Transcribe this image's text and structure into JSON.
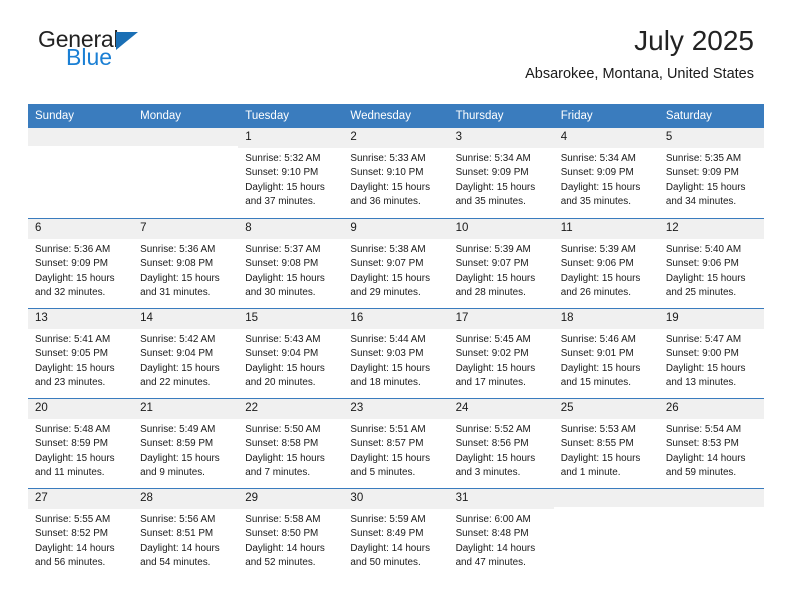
{
  "brand": {
    "line1": "General",
    "line2": "Blue",
    "triangle_color": "#1a6fb5",
    "blue_color": "#1a7fd4"
  },
  "header": {
    "title": "July 2025",
    "subtitle": "Absarokee, Montana, United States"
  },
  "theme": {
    "header_blue": "#3a7cbe",
    "daynum_band": "#f0f0f0",
    "text": "#1a1a1a"
  },
  "weekdays": [
    "Sunday",
    "Monday",
    "Tuesday",
    "Wednesday",
    "Thursday",
    "Friday",
    "Saturday"
  ],
  "labels": {
    "sunrise": "Sunrise:",
    "sunset": "Sunset:",
    "daylight": "Daylight:"
  },
  "weeks": [
    [
      {
        "day": "",
        "empty": true
      },
      {
        "day": "",
        "empty": true
      },
      {
        "day": "1",
        "sunrise": "Sunrise: 5:32 AM",
        "sunset": "Sunset: 9:10 PM",
        "daylight": "Daylight: 15 hours and 37 minutes."
      },
      {
        "day": "2",
        "sunrise": "Sunrise: 5:33 AM",
        "sunset": "Sunset: 9:10 PM",
        "daylight": "Daylight: 15 hours and 36 minutes."
      },
      {
        "day": "3",
        "sunrise": "Sunrise: 5:34 AM",
        "sunset": "Sunset: 9:09 PM",
        "daylight": "Daylight: 15 hours and 35 minutes."
      },
      {
        "day": "4",
        "sunrise": "Sunrise: 5:34 AM",
        "sunset": "Sunset: 9:09 PM",
        "daylight": "Daylight: 15 hours and 35 minutes."
      },
      {
        "day": "5",
        "sunrise": "Sunrise: 5:35 AM",
        "sunset": "Sunset: 9:09 PM",
        "daylight": "Daylight: 15 hours and 34 minutes."
      }
    ],
    [
      {
        "day": "6",
        "sunrise": "Sunrise: 5:36 AM",
        "sunset": "Sunset: 9:09 PM",
        "daylight": "Daylight: 15 hours and 32 minutes."
      },
      {
        "day": "7",
        "sunrise": "Sunrise: 5:36 AM",
        "sunset": "Sunset: 9:08 PM",
        "daylight": "Daylight: 15 hours and 31 minutes."
      },
      {
        "day": "8",
        "sunrise": "Sunrise: 5:37 AM",
        "sunset": "Sunset: 9:08 PM",
        "daylight": "Daylight: 15 hours and 30 minutes."
      },
      {
        "day": "9",
        "sunrise": "Sunrise: 5:38 AM",
        "sunset": "Sunset: 9:07 PM",
        "daylight": "Daylight: 15 hours and 29 minutes."
      },
      {
        "day": "10",
        "sunrise": "Sunrise: 5:39 AM",
        "sunset": "Sunset: 9:07 PM",
        "daylight": "Daylight: 15 hours and 28 minutes."
      },
      {
        "day": "11",
        "sunrise": "Sunrise: 5:39 AM",
        "sunset": "Sunset: 9:06 PM",
        "daylight": "Daylight: 15 hours and 26 minutes."
      },
      {
        "day": "12",
        "sunrise": "Sunrise: 5:40 AM",
        "sunset": "Sunset: 9:06 PM",
        "daylight": "Daylight: 15 hours and 25 minutes."
      }
    ],
    [
      {
        "day": "13",
        "sunrise": "Sunrise: 5:41 AM",
        "sunset": "Sunset: 9:05 PM",
        "daylight": "Daylight: 15 hours and 23 minutes."
      },
      {
        "day": "14",
        "sunrise": "Sunrise: 5:42 AM",
        "sunset": "Sunset: 9:04 PM",
        "daylight": "Daylight: 15 hours and 22 minutes."
      },
      {
        "day": "15",
        "sunrise": "Sunrise: 5:43 AM",
        "sunset": "Sunset: 9:04 PM",
        "daylight": "Daylight: 15 hours and 20 minutes."
      },
      {
        "day": "16",
        "sunrise": "Sunrise: 5:44 AM",
        "sunset": "Sunset: 9:03 PM",
        "daylight": "Daylight: 15 hours and 18 minutes."
      },
      {
        "day": "17",
        "sunrise": "Sunrise: 5:45 AM",
        "sunset": "Sunset: 9:02 PM",
        "daylight": "Daylight: 15 hours and 17 minutes."
      },
      {
        "day": "18",
        "sunrise": "Sunrise: 5:46 AM",
        "sunset": "Sunset: 9:01 PM",
        "daylight": "Daylight: 15 hours and 15 minutes."
      },
      {
        "day": "19",
        "sunrise": "Sunrise: 5:47 AM",
        "sunset": "Sunset: 9:00 PM",
        "daylight": "Daylight: 15 hours and 13 minutes."
      }
    ],
    [
      {
        "day": "20",
        "sunrise": "Sunrise: 5:48 AM",
        "sunset": "Sunset: 8:59 PM",
        "daylight": "Daylight: 15 hours and 11 minutes."
      },
      {
        "day": "21",
        "sunrise": "Sunrise: 5:49 AM",
        "sunset": "Sunset: 8:59 PM",
        "daylight": "Daylight: 15 hours and 9 minutes."
      },
      {
        "day": "22",
        "sunrise": "Sunrise: 5:50 AM",
        "sunset": "Sunset: 8:58 PM",
        "daylight": "Daylight: 15 hours and 7 minutes."
      },
      {
        "day": "23",
        "sunrise": "Sunrise: 5:51 AM",
        "sunset": "Sunset: 8:57 PM",
        "daylight": "Daylight: 15 hours and 5 minutes."
      },
      {
        "day": "24",
        "sunrise": "Sunrise: 5:52 AM",
        "sunset": "Sunset: 8:56 PM",
        "daylight": "Daylight: 15 hours and 3 minutes."
      },
      {
        "day": "25",
        "sunrise": "Sunrise: 5:53 AM",
        "sunset": "Sunset: 8:55 PM",
        "daylight": "Daylight: 15 hours and 1 minute."
      },
      {
        "day": "26",
        "sunrise": "Sunrise: 5:54 AM",
        "sunset": "Sunset: 8:53 PM",
        "daylight": "Daylight: 14 hours and 59 minutes."
      }
    ],
    [
      {
        "day": "27",
        "sunrise": "Sunrise: 5:55 AM",
        "sunset": "Sunset: 8:52 PM",
        "daylight": "Daylight: 14 hours and 56 minutes."
      },
      {
        "day": "28",
        "sunrise": "Sunrise: 5:56 AM",
        "sunset": "Sunset: 8:51 PM",
        "daylight": "Daylight: 14 hours and 54 minutes."
      },
      {
        "day": "29",
        "sunrise": "Sunrise: 5:58 AM",
        "sunset": "Sunset: 8:50 PM",
        "daylight": "Daylight: 14 hours and 52 minutes."
      },
      {
        "day": "30",
        "sunrise": "Sunrise: 5:59 AM",
        "sunset": "Sunset: 8:49 PM",
        "daylight": "Daylight: 14 hours and 50 minutes."
      },
      {
        "day": "31",
        "sunrise": "Sunrise: 6:00 AM",
        "sunset": "Sunset: 8:48 PM",
        "daylight": "Daylight: 14 hours and 47 minutes."
      },
      {
        "day": "",
        "empty": true
      },
      {
        "day": "",
        "empty": true
      }
    ]
  ]
}
